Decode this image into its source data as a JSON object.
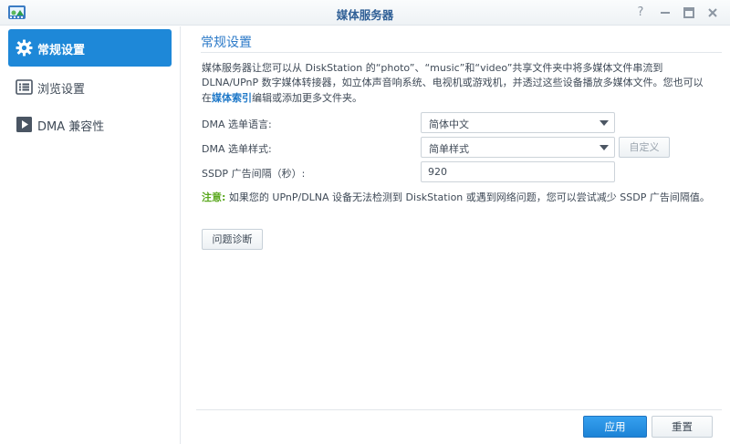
{
  "window": {
    "title": "媒体服务器",
    "app_icon": "media-server-icon",
    "controls": [
      "help-icon",
      "minimize-icon",
      "maximize-icon",
      "close-icon"
    ]
  },
  "sidebar": {
    "items": [
      {
        "label": "常规设置",
        "icon": "gear-icon",
        "active": true
      },
      {
        "label": "浏览设置",
        "icon": "browse-list-icon",
        "active": false
      },
      {
        "label": "DMA 兼容性",
        "icon": "play-icon",
        "active": false
      }
    ]
  },
  "main": {
    "section_title": "常规设置",
    "description_part1": "媒体服务器让您可以从 DiskStation 的“photo”、“music”和“video”共享文件夹中将多媒体文件串流到 DLNA/UPnP 数字媒体转接器，如立体声音响系统、电视机或游戏机，并透过这些设备播放多媒体文件。您也可以在",
    "description_link": "媒体索引",
    "description_part2": "编辑或添加更多文件夹。",
    "dma_language_label": "DMA 选单语言:",
    "dma_language_value": "简体中文",
    "dma_style_label": "DMA 选单样式:",
    "dma_style_value": "简单样式",
    "customize_button": "自定义",
    "ssdp_label": "SSDP 广告间隔（秒）:",
    "ssdp_value": "920",
    "note_tag": "注意:",
    "note_text": "如果您的 UPnP/DLNA 设备无法检测到 DiskStation 或遇到网络问题，您可以尝试减少 SSDP 广告间隔值。",
    "diagnose_button": "问题诊断"
  },
  "footer": {
    "apply": "应用",
    "reset": "重置"
  },
  "colors": {
    "accent": "#1e88d8",
    "title": "#2f5f96",
    "note": "#5aa81e"
  }
}
